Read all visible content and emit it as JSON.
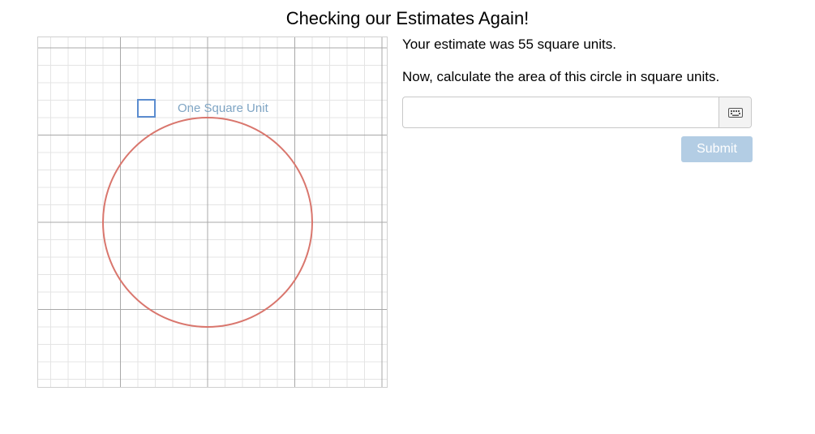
{
  "header": {
    "title": "Checking our Estimates Again!"
  },
  "graph": {
    "unit_label": "One Square Unit",
    "colors": {
      "circle": "#d9766d",
      "unit_square": "#5b8ccf",
      "grid_major": "#a8a8a8",
      "grid_minor": "#e4e4e4"
    }
  },
  "panel": {
    "estimate_text": "Your estimate was 55 square units.",
    "prompt_text": "Now, calculate the area of this circle in square units.",
    "answer_value": "",
    "answer_placeholder": "",
    "keyboard_icon": "keyboard-icon",
    "submit_label": "Submit"
  }
}
